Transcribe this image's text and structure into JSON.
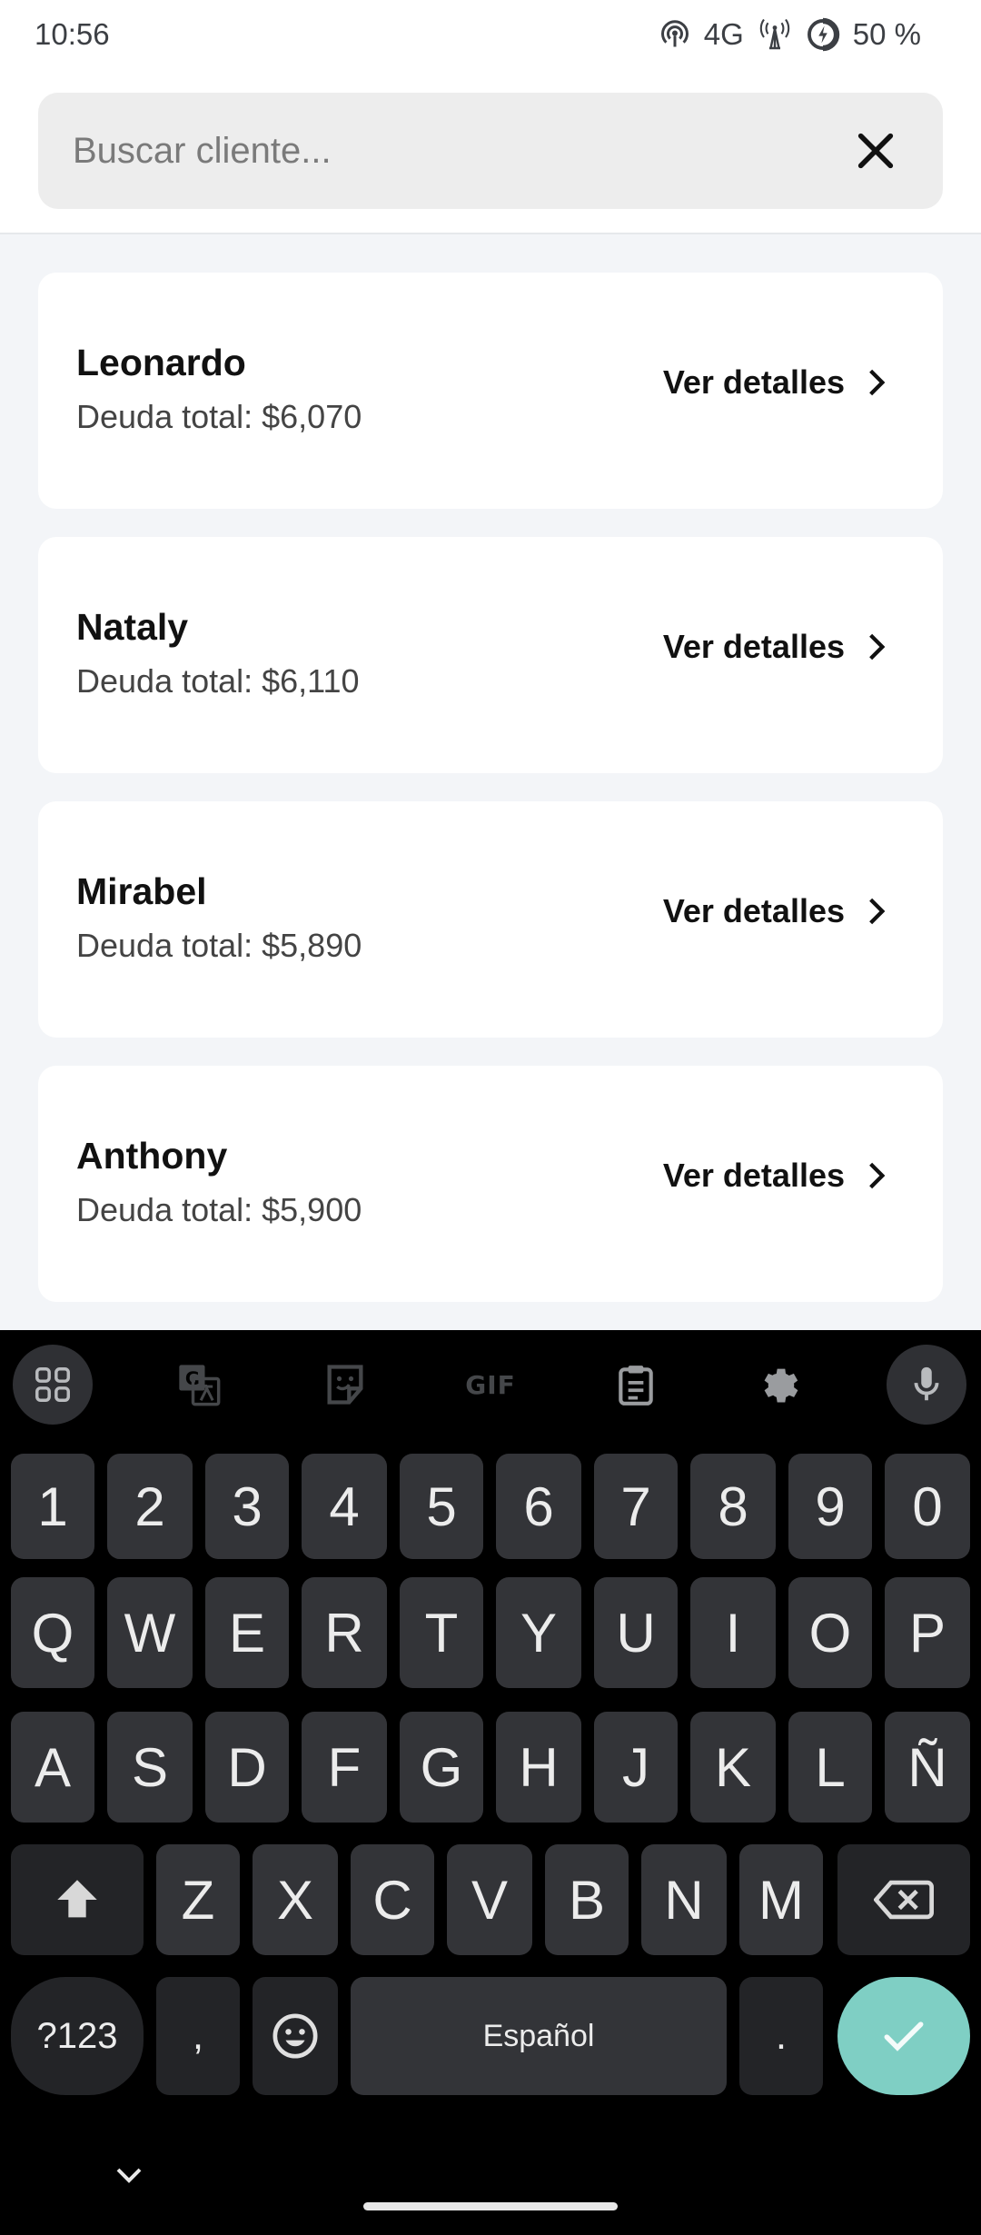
{
  "status": {
    "time": "10:56",
    "network": "4G",
    "battery": "50 %"
  },
  "search": {
    "placeholder": "Buscar cliente..."
  },
  "clients": [
    {
      "name": "Leonardo",
      "debt": "Deuda total: $6,070",
      "action": "Ver detalles"
    },
    {
      "name": "Nataly",
      "debt": "Deuda total: $6,110",
      "action": "Ver detalles"
    },
    {
      "name": "Mirabel",
      "debt": "Deuda total: $5,890",
      "action": "Ver detalles"
    },
    {
      "name": "Anthony",
      "debt": "Deuda total: $5,900",
      "action": "Ver detalles"
    }
  ],
  "keyboard": {
    "toolbar_gif": "GIF",
    "row_numbers": [
      "1",
      "2",
      "3",
      "4",
      "5",
      "6",
      "7",
      "8",
      "9",
      "0"
    ],
    "row1": [
      "Q",
      "W",
      "E",
      "R",
      "T",
      "Y",
      "U",
      "I",
      "O",
      "P"
    ],
    "row2": [
      "A",
      "S",
      "D",
      "F",
      "G",
      "H",
      "J",
      "K",
      "L",
      "Ñ"
    ],
    "row3": [
      "Z",
      "X",
      "C",
      "V",
      "B",
      "N",
      "M"
    ],
    "symbols": "?123",
    "comma": ",",
    "space": "Español",
    "period": ".",
    "accent_color": "#7fcfc4"
  }
}
